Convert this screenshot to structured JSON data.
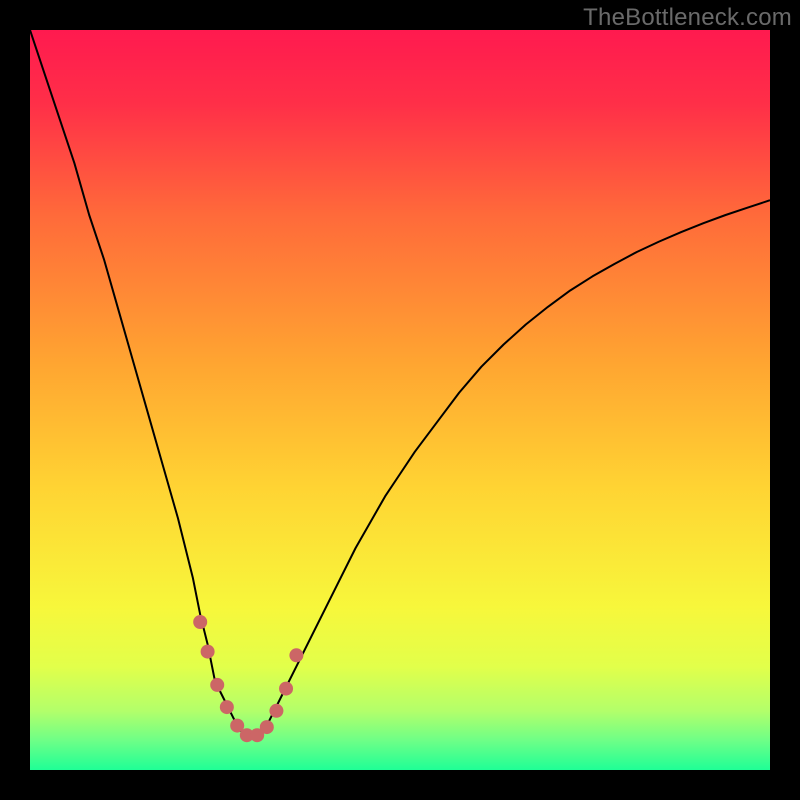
{
  "watermark": "TheBottleneck.com",
  "chart_data": {
    "type": "line",
    "title": "",
    "xlabel": "",
    "ylabel": "",
    "xlim": [
      0,
      100
    ],
    "ylim": [
      0,
      100
    ],
    "grid": false,
    "series": [
      {
        "name": "curve",
        "stroke": "#000000",
        "stroke_width": 2.0,
        "x": [
          0,
          2,
          4,
          6,
          8,
          10,
          12,
          14,
          16,
          18,
          20,
          21,
          22,
          23,
          24,
          25,
          26,
          27,
          28,
          28.7,
          29.5,
          30.5,
          31.2,
          32,
          33,
          34,
          36,
          38,
          40,
          42,
          44,
          46,
          48,
          50,
          52,
          55,
          58,
          61,
          64,
          67,
          70,
          73,
          76,
          79,
          82,
          85,
          88,
          91,
          94,
          97,
          100
        ],
        "y": [
          100,
          94,
          88,
          82,
          75,
          69,
          62,
          55,
          48,
          41,
          34,
          30,
          26,
          21,
          17,
          12,
          10,
          8,
          6,
          5,
          4.5,
          4.5,
          5,
          6,
          8,
          10,
          14,
          18,
          22,
          26,
          30,
          33.5,
          37,
          40,
          43,
          47,
          51,
          54.5,
          57.5,
          60.2,
          62.6,
          64.8,
          66.7,
          68.4,
          70,
          71.4,
          72.7,
          73.9,
          75,
          76,
          77
        ]
      },
      {
        "name": "marker-dots",
        "stroke": "#cc6666",
        "stroke_width": 14,
        "linecap": "round",
        "x": [
          23.0,
          24.0,
          25.3,
          26.6,
          28.0,
          29.3,
          30.7,
          32.0,
          33.3,
          34.6,
          36.0
        ],
        "y": [
          20.0,
          16.0,
          11.5,
          8.5,
          6.0,
          4.7,
          4.7,
          5.8,
          8.0,
          11.0,
          15.5
        ]
      }
    ],
    "background_gradient": {
      "type": "vertical",
      "stops": [
        {
          "offset": 0.0,
          "color": "#ff1a4f"
        },
        {
          "offset": 0.1,
          "color": "#ff2f48"
        },
        {
          "offset": 0.25,
          "color": "#ff6a3a"
        },
        {
          "offset": 0.45,
          "color": "#ffa531"
        },
        {
          "offset": 0.62,
          "color": "#ffd433"
        },
        {
          "offset": 0.78,
          "color": "#f7f73b"
        },
        {
          "offset": 0.86,
          "color": "#e2ff4a"
        },
        {
          "offset": 0.92,
          "color": "#b3ff6a"
        },
        {
          "offset": 0.96,
          "color": "#6eff87"
        },
        {
          "offset": 1.0,
          "color": "#1fff96"
        }
      ]
    }
  }
}
